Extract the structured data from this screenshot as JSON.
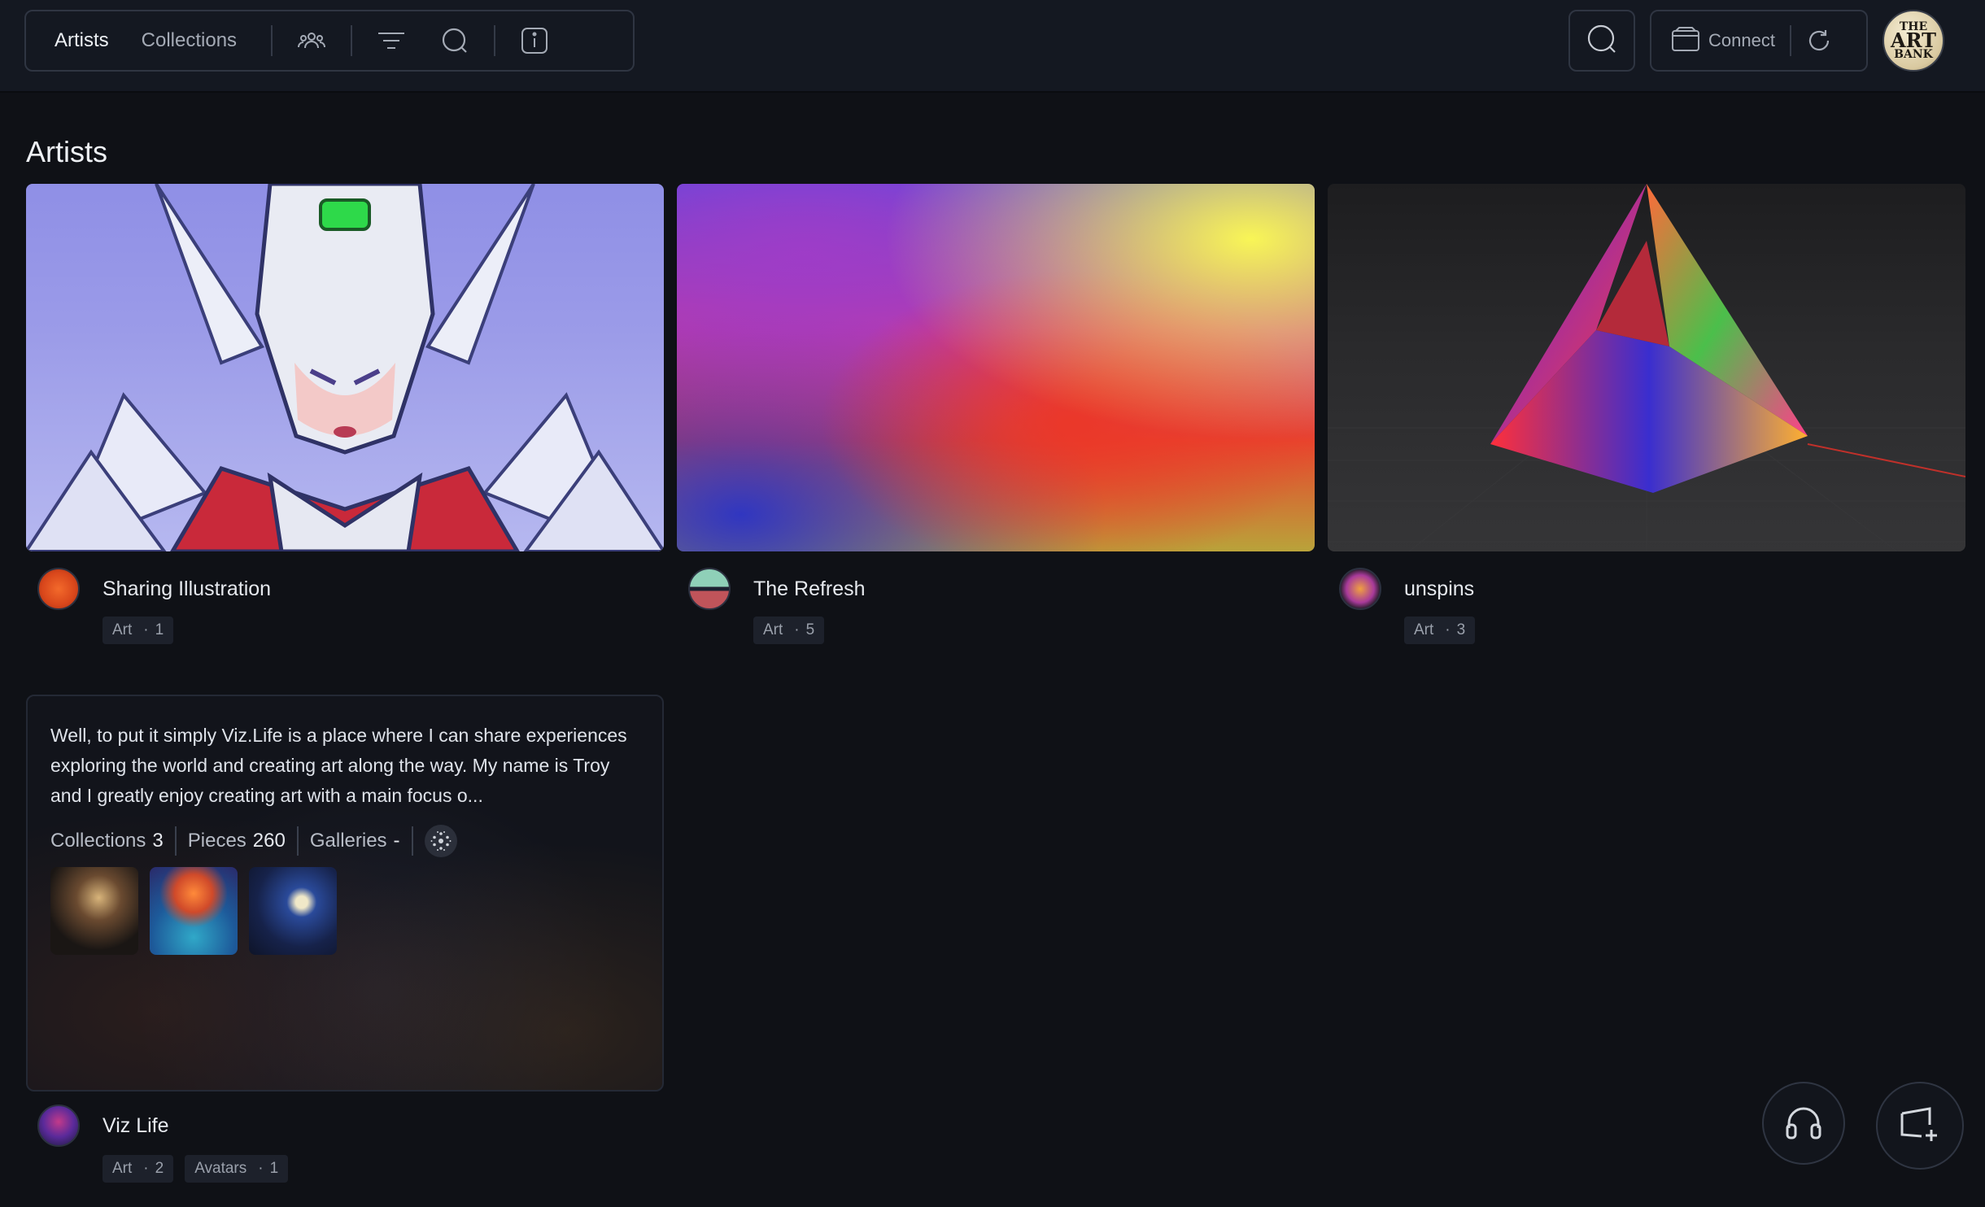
{
  "nav": {
    "tabs": [
      {
        "label": "Artists",
        "active": true
      },
      {
        "label": "Collections",
        "active": false
      }
    ],
    "icons": [
      "people-icon",
      "filter-icon",
      "search-icon",
      "info-icon"
    ]
  },
  "header": {
    "connect_label": "Connect",
    "logo_lines": [
      "THE",
      "ART",
      "BANK"
    ]
  },
  "page": {
    "title": "Artists"
  },
  "artists": [
    {
      "name": "Sharing Illustration",
      "chips": [
        {
          "label": "Art",
          "count": "1"
        }
      ]
    },
    {
      "name": "The Refresh",
      "chips": [
        {
          "label": "Art",
          "count": "5"
        }
      ]
    },
    {
      "name": "unspins",
      "chips": [
        {
          "label": "Art",
          "count": "3"
        }
      ]
    },
    {
      "name": "Viz Life",
      "chips": [
        {
          "label": "Art",
          "count": "2"
        },
        {
          "label": "Avatars",
          "count": "1"
        }
      ]
    }
  ],
  "featured_bio": {
    "text": "Well, to put it simply Viz.Life is a place where I can share experiences exploring the world and creating art along the way. My name is Troy and I greatly enjoy creating art with a main focus o...",
    "stats": [
      {
        "label": "Collections",
        "value": "3"
      },
      {
        "label": "Pieces",
        "value": "260"
      },
      {
        "label": "Galleries",
        "value": "-"
      }
    ]
  },
  "colors": {
    "background": "#0f1116",
    "topbar": "#141821",
    "border": "#2f3542",
    "chip_bg": "#1d212b"
  }
}
